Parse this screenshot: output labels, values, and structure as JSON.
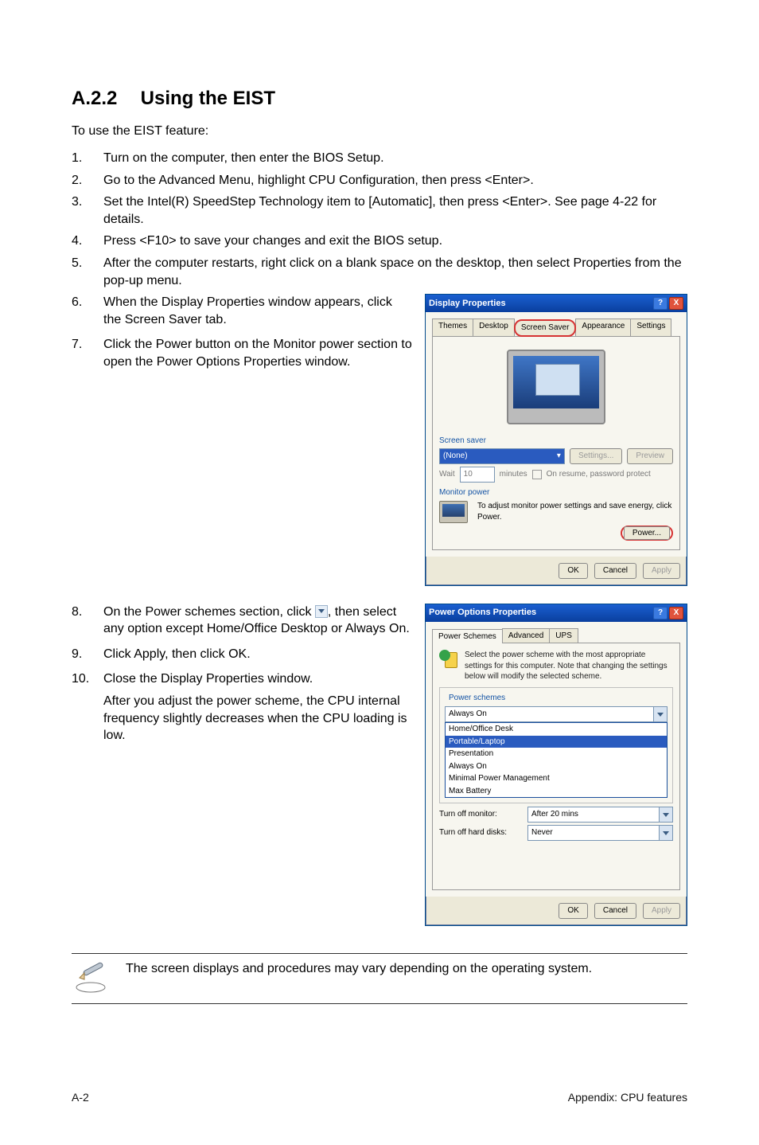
{
  "section": {
    "number": "A.2.2",
    "title": "Using the EIST"
  },
  "intro": "To use the EIST feature:",
  "steps": [
    {
      "n": "1.",
      "t": "Turn on the computer, then enter the BIOS Setup."
    },
    {
      "n": "2.",
      "t": "Go to the Advanced Menu, highlight CPU Configuration, then press <Enter>."
    },
    {
      "n": "3.",
      "t": "Set the Intel(R) SpeedStep Technology item to [Automatic], then press <Enter>. See page 4-22 for details."
    },
    {
      "n": "4.",
      "t": "Press <F10> to save your changes and exit the BIOS setup."
    },
    {
      "n": "5.",
      "t": "After the computer restarts, right click on a blank space on the desktop, then select Properties from the pop-up menu."
    },
    {
      "n": "6.",
      "t": "When the Display Properties window appears, click the Screen Saver tab."
    },
    {
      "n": "7.",
      "t": "Click the Power button on the Monitor power section to open the Power Options Properties window."
    },
    {
      "n": "8.",
      "pre": "On the Power schemes section, click ",
      "post": ", then select any option except Home/Office Desktop or Always On."
    },
    {
      "n": "9.",
      "t": "Click Apply, then click OK."
    },
    {
      "n": "10.",
      "t": "Close the Display Properties window."
    }
  ],
  "after_note": "After you adjust the power scheme, the CPU internal frequency slightly decreases when the CPU loading is low.",
  "dp": {
    "title": "Display Properties",
    "tabs": [
      "Themes",
      "Desktop",
      "Screen Saver",
      "Appearance",
      "Settings"
    ],
    "screensaver_label": "Screen saver",
    "ss_value": "(None)",
    "settings_btn": "Settings...",
    "preview_btn": "Preview",
    "wait_label": "Wait",
    "wait_value": "10",
    "wait_unit": "minutes",
    "resume_chk": "On resume, password protect",
    "monitor_label": "Monitor power",
    "monitor_text": "To adjust monitor power settings and save energy, click Power.",
    "power_btn": "Power...",
    "ok": "OK",
    "cancel": "Cancel",
    "apply": "Apply"
  },
  "po": {
    "title": "Power Options Properties",
    "tabs": [
      "Power Schemes",
      "Advanced",
      "UPS"
    ],
    "desc": "Select the power scheme with the most appropriate settings for this computer. Note that changing the settings below will modify the selected scheme.",
    "schemes_label": "Power schemes",
    "scheme_value": "Always On",
    "options": [
      "Home/Office Desk",
      "Portable/Laptop",
      "Presentation",
      "Always On",
      "Minimal Power Management",
      "Max Battery"
    ],
    "selected_index": 1,
    "mon_label": "Turn off monitor:",
    "mon_value": "After 20 mins",
    "hd_label": "Turn off hard disks:",
    "hd_value": "Never",
    "ok": "OK",
    "cancel": "Cancel",
    "apply": "Apply"
  },
  "footnote": "The screen displays and procedures may vary depending on the operating system.",
  "footer": {
    "left": "A-2",
    "right": "Appendix: CPU features"
  }
}
